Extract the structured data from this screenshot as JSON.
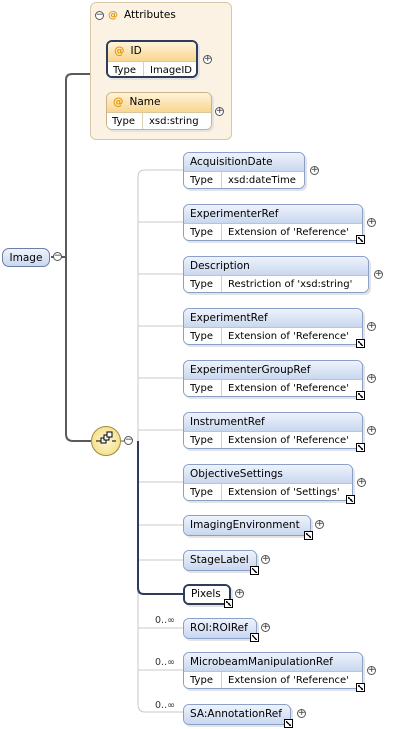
{
  "root": {
    "label": "Image"
  },
  "attributes": {
    "title": "Attributes",
    "items": [
      {
        "name": "ID",
        "type_key": "Type",
        "type": "ImageID"
      },
      {
        "name": "Name",
        "type_key": "Type",
        "type": "xsd:string"
      }
    ]
  },
  "sequence": {
    "icon": "sequence-compositor-icon"
  },
  "children": [
    {
      "name": "AcquisitionDate",
      "type_key": "Type",
      "type": "xsd:dateTime"
    },
    {
      "name": "ExperimenterRef",
      "type_key": "Type",
      "type": "Extension of 'Reference'"
    },
    {
      "name": "Description",
      "type_key": "Type",
      "type": "Restriction of 'xsd:string'"
    },
    {
      "name": "ExperimentRef",
      "type_key": "Type",
      "type": "Extension of 'Reference'"
    },
    {
      "name": "ExperimenterGroupRef",
      "type_key": "Type",
      "type": "Extension of 'Reference'"
    },
    {
      "name": "InstrumentRef",
      "type_key": "Type",
      "type": "Extension of 'Reference'"
    },
    {
      "name": "ObjectiveSettings",
      "type_key": "Type",
      "type": "Extension of 'Settings'"
    },
    {
      "name": "ImagingEnvironment"
    },
    {
      "name": "StageLabel"
    },
    {
      "name": "Pixels"
    },
    {
      "name": "ROI:ROIRef",
      "occurrence": "0..∞"
    },
    {
      "name": "MicrobeamManipulationRef",
      "occurrence": "0..∞",
      "type_key": "Type",
      "type": "Extension of 'Reference'"
    },
    {
      "name": "SA:AnnotationRef",
      "occurrence": "0..∞"
    }
  ]
}
